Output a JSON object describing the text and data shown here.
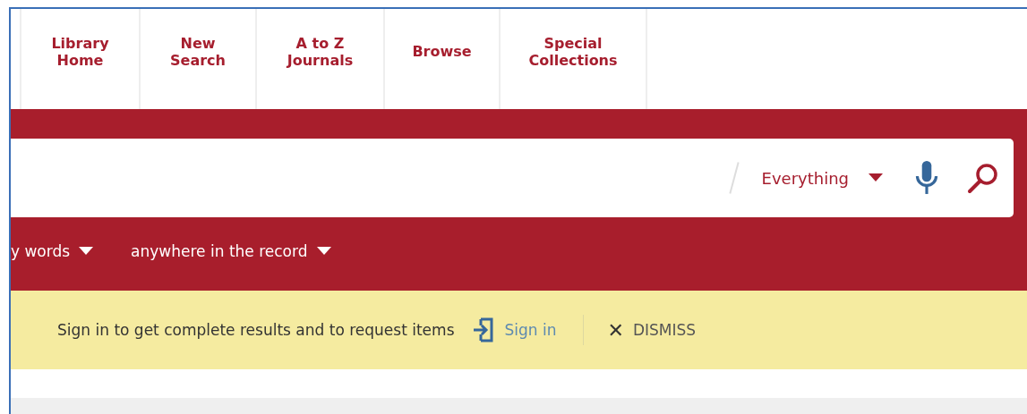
{
  "nav": [
    {
      "label": "Library\nHome"
    },
    {
      "label": "New\nSearch"
    },
    {
      "label": "A to Z\nJournals"
    },
    {
      "label": "Browse"
    },
    {
      "label": "Special\nCollections"
    }
  ],
  "search": {
    "scope": "Everything"
  },
  "filters": [
    {
      "label": "y words"
    },
    {
      "label": "anywhere in the record"
    }
  ],
  "banner": {
    "message": "Sign in to get complete results and to request items",
    "sign_in": "Sign in",
    "dismiss": "DISMISS",
    "dismiss_glyph": "✕"
  }
}
